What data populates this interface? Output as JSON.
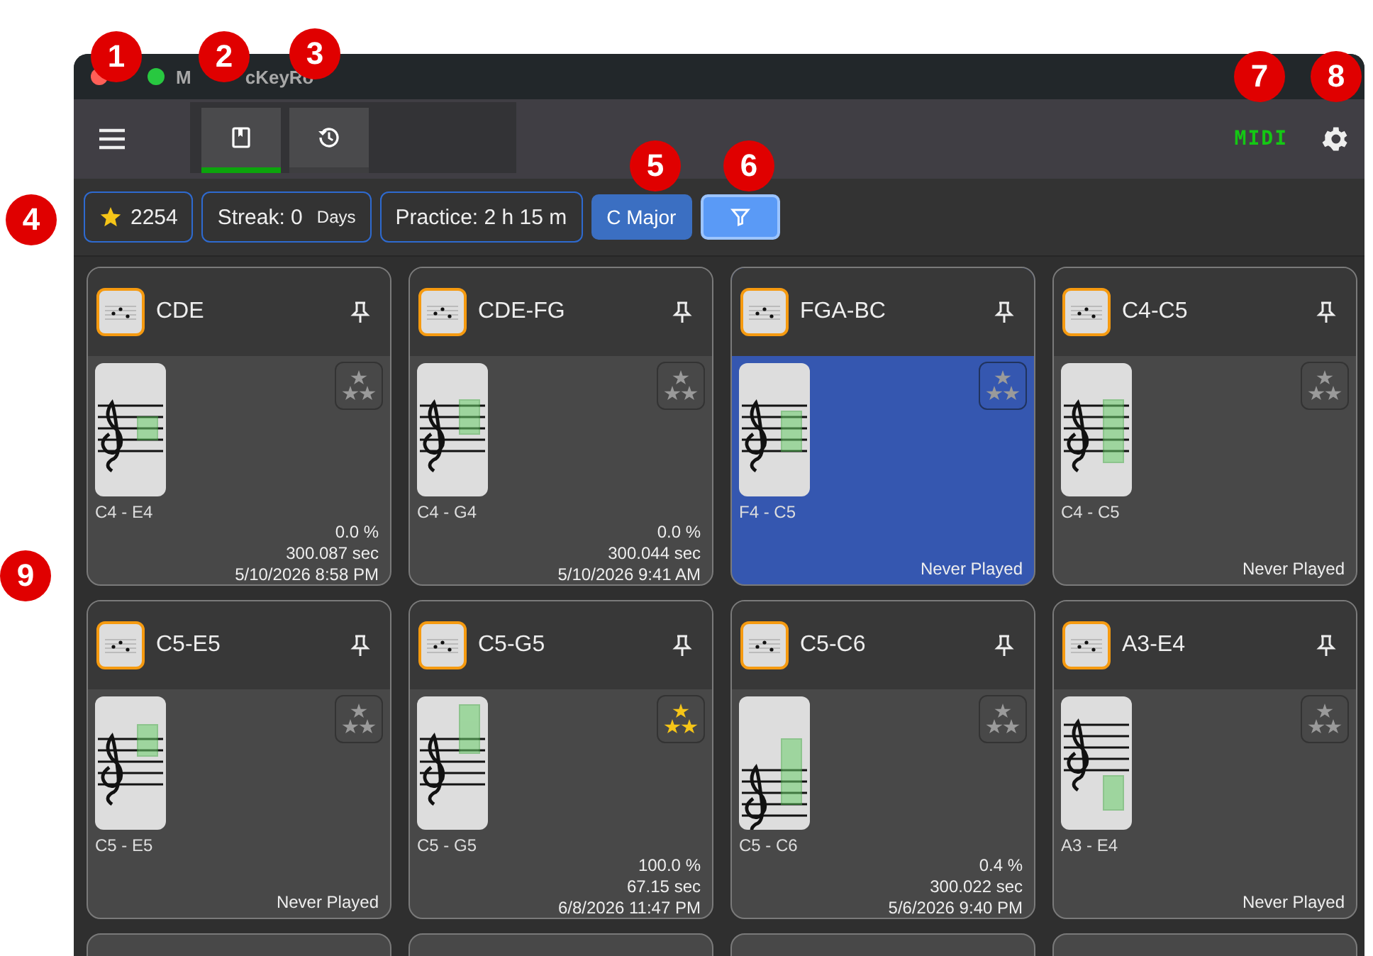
{
  "window": {
    "title_parts": [
      "M",
      "cKeyRo"
    ]
  },
  "toolbar": {
    "tabs": [
      {
        "kind": "book",
        "selected": true
      },
      {
        "kind": "history",
        "selected": false
      }
    ],
    "midi_label": "MIDI"
  },
  "stats": {
    "stars": "2254",
    "streak_label": "Streak: 0",
    "streak_unit": "Days",
    "practice": "Practice: 2 h 15 m",
    "key_button": "C Major",
    "filter_active": true
  },
  "cards": [
    {
      "title": "CDE",
      "range": "C4 - E4",
      "achieved": false,
      "selected": false,
      "stats": [
        "0.0 %",
        "300.087 sec",
        "5/10/2026 8:58 PM"
      ]
    },
    {
      "title": "CDE-FG",
      "range": "C4 - G4",
      "achieved": false,
      "selected": false,
      "stats": [
        "0.0 %",
        "300.044 sec",
        "5/10/2026 9:41 AM"
      ]
    },
    {
      "title": "FGA-BC",
      "range": "F4 - C5",
      "achieved": false,
      "selected": true,
      "stats": [
        "Never Played"
      ]
    },
    {
      "title": "C4-C5",
      "range": "C4 - C5",
      "achieved": false,
      "selected": false,
      "stats": [
        "Never Played"
      ]
    },
    {
      "title": "C5-E5",
      "range": "C5 - E5",
      "achieved": false,
      "selected": false,
      "stats": [
        "Never Played"
      ]
    },
    {
      "title": "C5-G5",
      "range": "C5 - G5",
      "achieved": true,
      "selected": false,
      "stats": [
        "100.0 %",
        "67.15 sec",
        "6/8/2026 11:47 PM"
      ]
    },
    {
      "title": "C5-C6",
      "range": "C5 - C6",
      "achieved": false,
      "selected": false,
      "stats": [
        "0.4 %",
        "300.022 sec",
        "5/6/2026 9:40 PM"
      ]
    },
    {
      "title": "A3-E4",
      "range": "A3 - E4",
      "achieved": false,
      "selected": false,
      "stats": [
        "Never Played"
      ]
    }
  ],
  "callouts": [
    "1",
    "2",
    "3",
    "4",
    "5",
    "6",
    "7",
    "8",
    "9"
  ]
}
